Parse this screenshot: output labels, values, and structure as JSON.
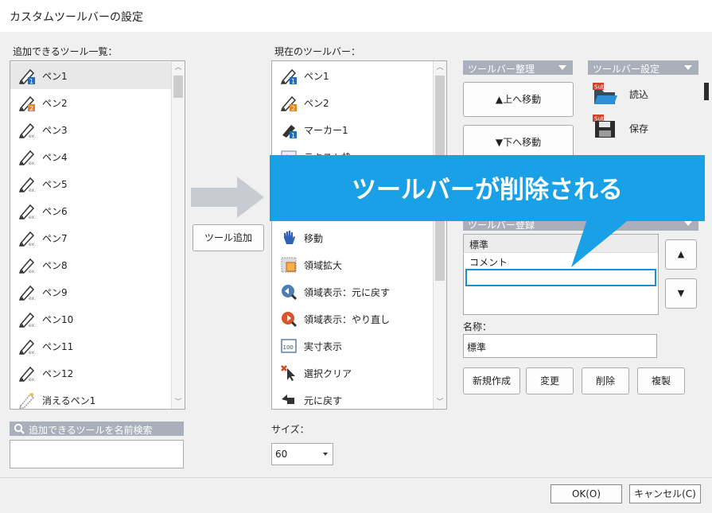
{
  "window": {
    "title": "カスタムツールバーの設定"
  },
  "available": {
    "label": "追加できるツール一覧：",
    "items": [
      "ペン1",
      "ペン2",
      "ペン3",
      "ペン4",
      "ペン5",
      "ペン6",
      "ペン7",
      "ペン8",
      "ペン9",
      "ペン10",
      "ペン11",
      "ペン12",
      "消えるペン1"
    ],
    "selected_index": 0,
    "search_label": "追加できるツールを名前検索",
    "search_value": ""
  },
  "add_button": "ツール追加",
  "current": {
    "label": "現在のツールバー：",
    "items": [
      "ペン1",
      "ペン2",
      "マーカー1",
      "テキスト枠",
      "",
      "",
      "移動",
      "領域拡大",
      "領域表示：元に戻す",
      "領域表示：やり直し",
      "実寸表示",
      "選択クリア",
      "元に戻す"
    ],
    "size_label": "サイズ：",
    "size_value": "60"
  },
  "organize": {
    "header": "ツールバー整理",
    "move_up": "▲上へ移動",
    "move_down": "▼下へ移動"
  },
  "settings": {
    "header": "ツールバー設定",
    "load": "読込",
    "save": "保存"
  },
  "register": {
    "header": "ツールバー登録",
    "items": [
      "標準",
      "コメント"
    ],
    "editing_value": "",
    "up": "▲",
    "down": "▼",
    "name_label": "名称：",
    "name_value": "標準",
    "new": "新規作成",
    "change": "変更",
    "delete": "削除",
    "duplicate": "複製"
  },
  "footer": {
    "ok": "OK(O)",
    "cancel": "キャンセル(C)"
  },
  "callout": {
    "text": "ツールバーが削除される"
  },
  "colors": {
    "callout": "#1aa0e6",
    "header": "#a9b0bb",
    "focus": "#1a8fd8"
  }
}
